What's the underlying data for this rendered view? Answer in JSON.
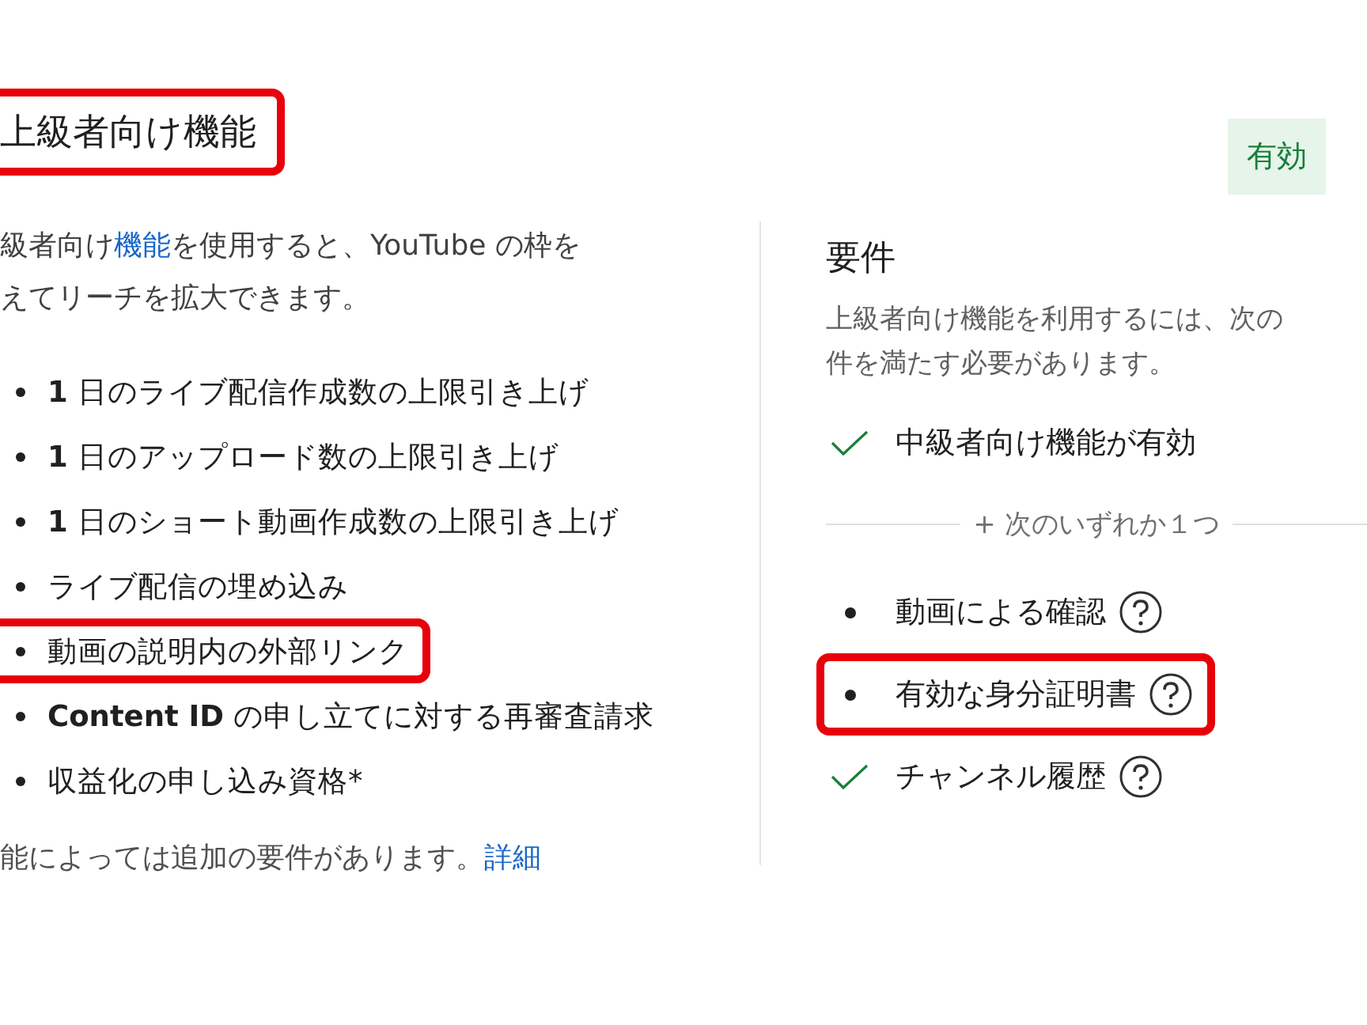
{
  "title": {
    "text": "上級者向け機能",
    "highlighted": true
  },
  "status_badge": "有効",
  "intro": {
    "before": "級者向け",
    "link": "機能",
    "after": "を使用すると、YouTube の枠を",
    "line_2": "えてリーチを拡大できます。"
  },
  "features": [
    {
      "text": "**1** 日のライブ配信作成数の上限引き上げ",
      "highlighted": false
    },
    {
      "text": "**1** 日のアップロード数の上限引き上げ",
      "highlighted": false
    },
    {
      "text": "**1** 日のショート動画作成数の上限引き上げ",
      "highlighted": false
    },
    {
      "text": "ライブ配信の埋め込み",
      "highlighted": false
    },
    {
      "text": "動画の説明内の外部リンク",
      "highlighted": true
    },
    {
      "text": "**Content ID** の申し立てに対する再審査請求",
      "highlighted": false
    },
    {
      "text": "収益化の申し込み資格*",
      "highlighted": false
    }
  ],
  "footer": {
    "text": "能によっては追加の要件があります。",
    "link": "詳細"
  },
  "requirements": {
    "title": "要件",
    "description": [
      "上級者向け機能を利用するには、次の",
      "件を満たす必要があります。"
    ],
    "base": [
      {
        "text": "中級者向け機能が有効",
        "done": true,
        "highlighted": false
      }
    ],
    "divider_label": "+ 次のいずれか１つ",
    "options": [
      {
        "text": "動画による確認",
        "done": false,
        "highlighted": false
      },
      {
        "text": "有効な身分証明書",
        "done": false,
        "highlighted": true
      },
      {
        "text": "チャンネル履歴",
        "done": true,
        "highlighted": false
      }
    ]
  }
}
